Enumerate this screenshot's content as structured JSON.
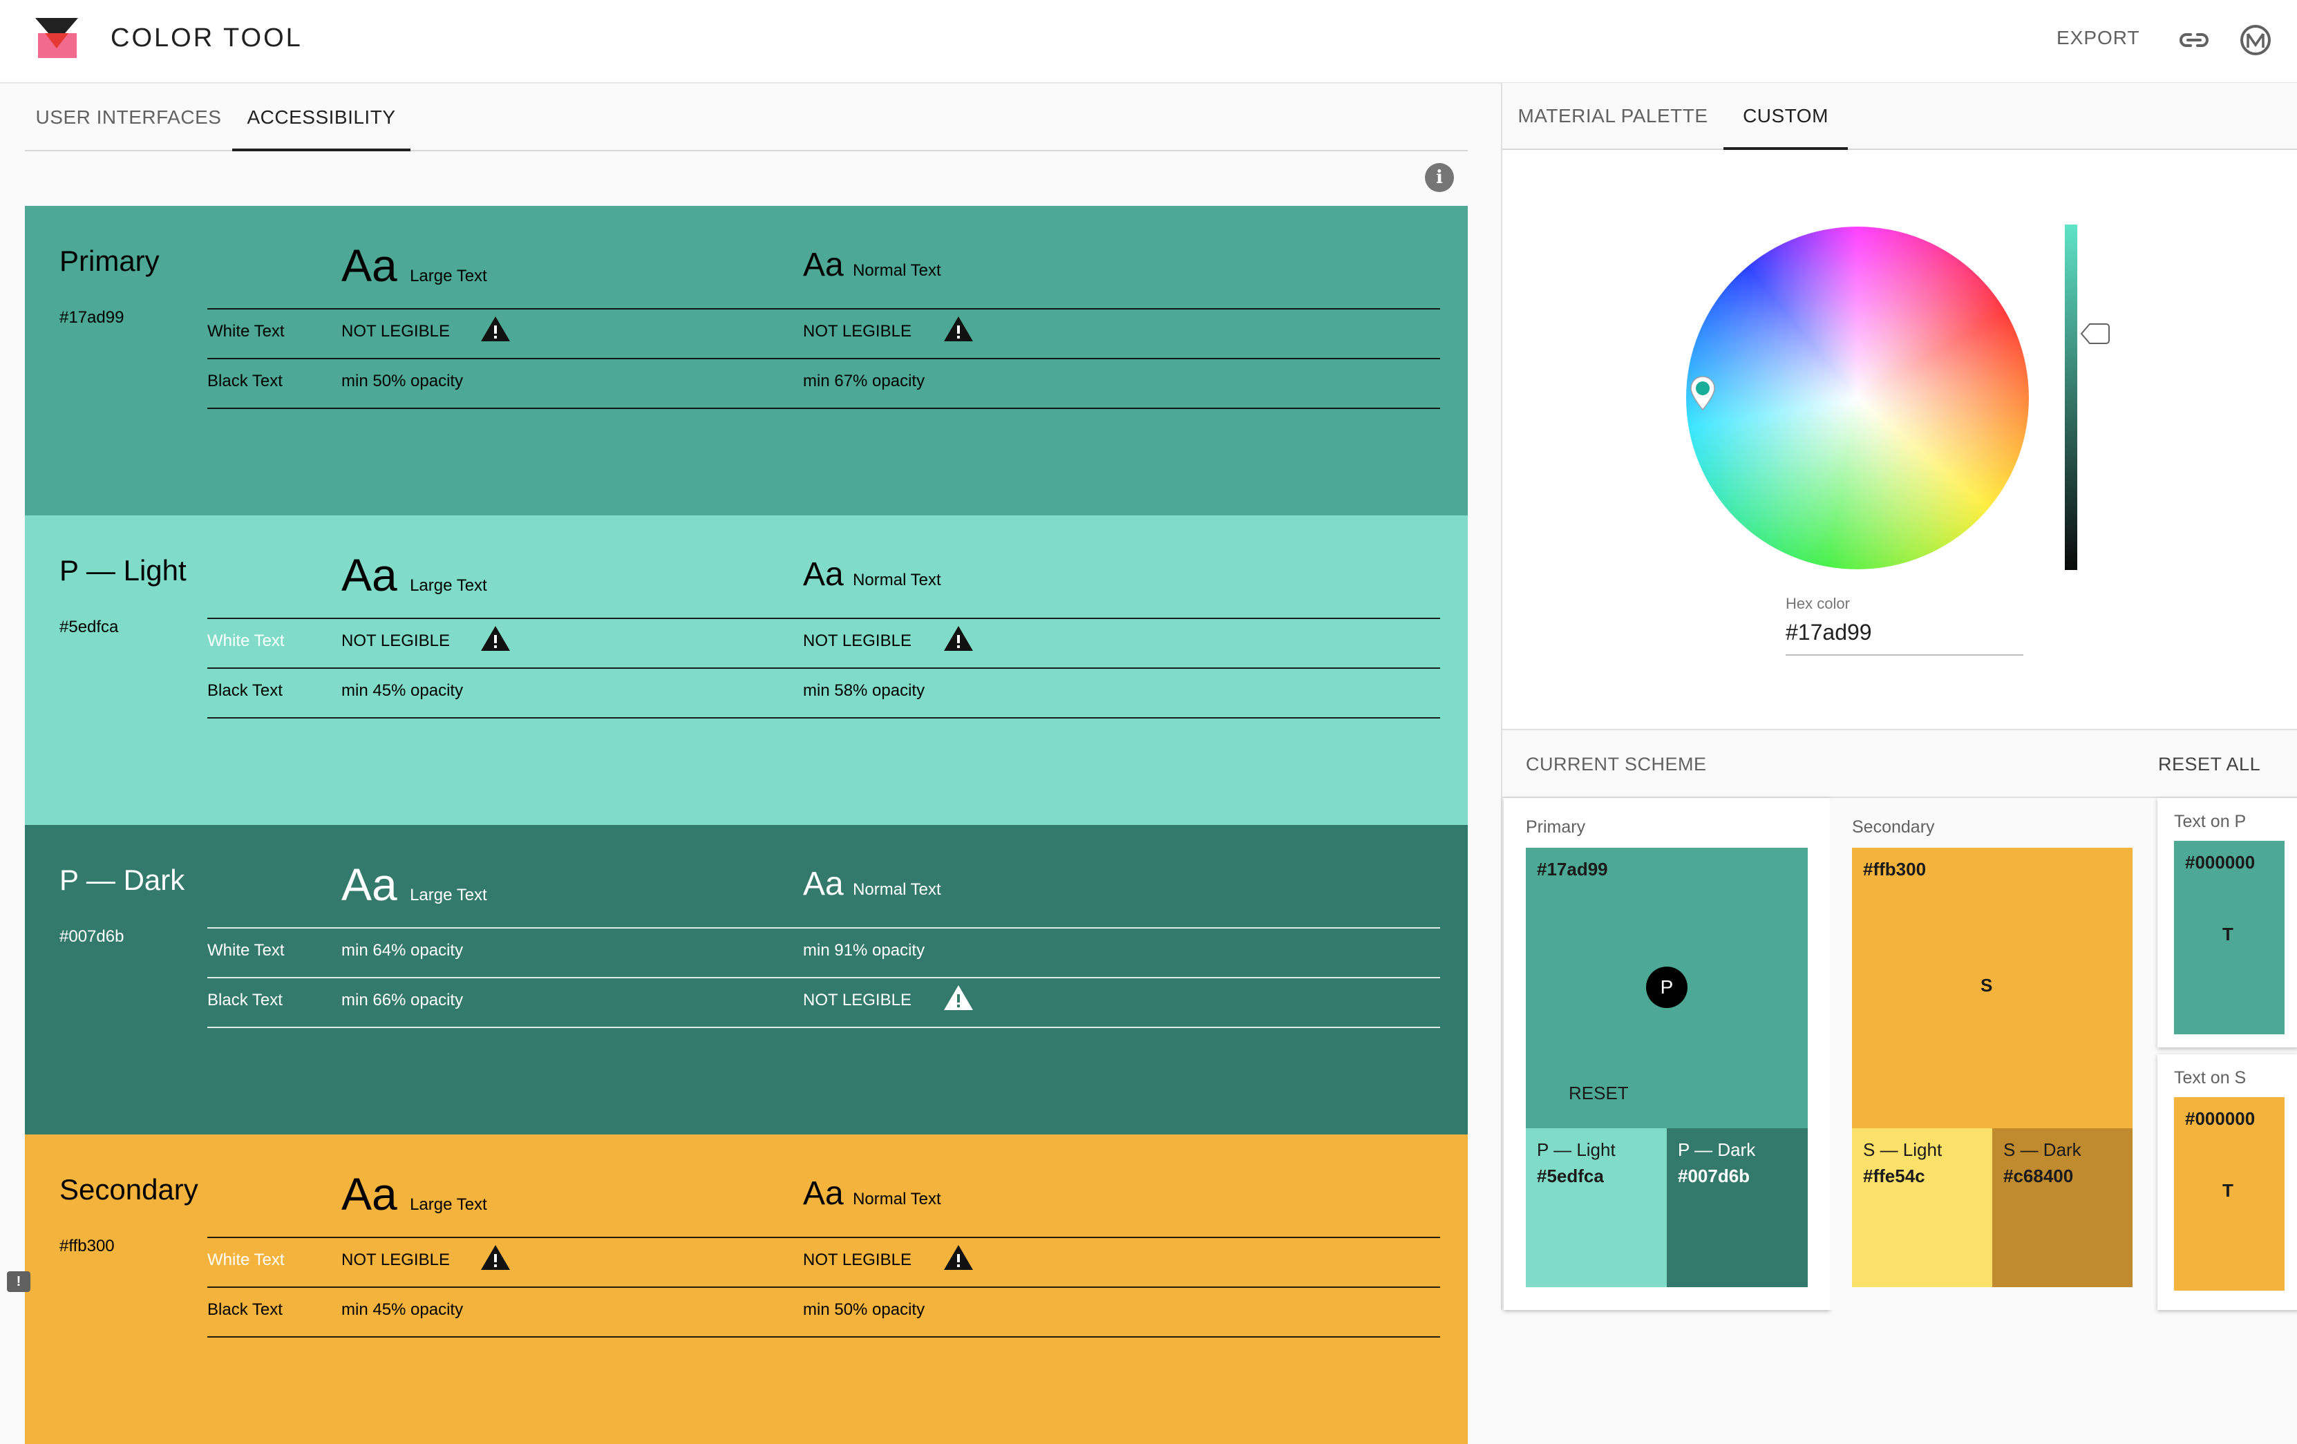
{
  "app": {
    "title": "COLOR  TOOL",
    "export_label": "EXPORT"
  },
  "left_tabs": [
    {
      "label": "USER INTERFACES",
      "active": false
    },
    {
      "label": "ACCESSIBILITY",
      "active": true
    }
  ],
  "right_tabs": [
    {
      "label": "MATERIAL PALETTE",
      "active": false
    },
    {
      "label": "CUSTOM",
      "active": true
    }
  ],
  "accessibility": {
    "large_text": "Large Text",
    "normal_text": "Normal Text",
    "aa": "Aa",
    "sections": [
      {
        "name": "Primary",
        "hex": "#17ad99",
        "bg": "#4ea896",
        "text_color": "#000000",
        "rows": [
          {
            "label": "White Text",
            "large": "NOT LEGIBLE",
            "large_warn": true,
            "normal": "NOT LEGIBLE",
            "normal_warn": true
          },
          {
            "label": "Black Text",
            "large": "min 50% opacity",
            "large_warn": false,
            "normal": "min 67% opacity",
            "normal_warn": false
          }
        ]
      },
      {
        "name": "P — Light",
        "hex": "#5edfca",
        "bg": "#80dcc8",
        "text_color": "#000000",
        "rows": [
          {
            "label": "White Text",
            "large": "NOT LEGIBLE",
            "large_warn": true,
            "normal": "NOT LEGIBLE",
            "normal_warn": true,
            "label_white": true
          },
          {
            "label": "Black Text",
            "large": "min 45% opacity",
            "large_warn": false,
            "normal": "min 58% opacity",
            "normal_warn": false
          }
        ]
      },
      {
        "name": "P — Dark",
        "hex": "#007d6b",
        "bg": "#347a6c",
        "text_color": "#ffffff",
        "rows": [
          {
            "label": "White Text",
            "large": "min 64% opacity",
            "large_warn": false,
            "normal": "min 91% opacity",
            "normal_warn": false
          },
          {
            "label": "Black Text",
            "large": "min 66% opacity",
            "large_warn": false,
            "normal": "NOT LEGIBLE",
            "normal_warn": true
          }
        ]
      },
      {
        "name": "Secondary",
        "hex": "#ffb300",
        "bg": "#f3b33d",
        "text_color": "#000000",
        "rows": [
          {
            "label": "White Text",
            "large": "NOT LEGIBLE",
            "large_warn": true,
            "normal": "NOT LEGIBLE",
            "normal_warn": true,
            "label_white": true
          },
          {
            "label": "Black Text",
            "large": "min 45% opacity",
            "large_warn": false,
            "normal": "min 50% opacity",
            "normal_warn": false
          }
        ]
      }
    ]
  },
  "custom": {
    "hex_label": "Hex color",
    "hex_value": "#17ad99"
  },
  "scheme": {
    "title": "CURRENT SCHEME",
    "reset_all": "RESET ALL",
    "primary": {
      "label": "Primary",
      "hex": "#17ad99",
      "badge": "P",
      "reset": "RESET",
      "light_title": "P — Light",
      "light_hex": "#5edfca",
      "dark_title": "P — Dark",
      "dark_hex": "#007d6b"
    },
    "secondary": {
      "label": "Secondary",
      "hex": "#ffb300",
      "badge": "S",
      "light_title": "S — Light",
      "light_hex": "#ffe54c",
      "dark_title": "S — Dark",
      "dark_hex": "#c68400"
    },
    "text_on_p": {
      "label": "Text on P",
      "hex": "#000000",
      "badge": "T"
    },
    "text_on_s": {
      "label": "Text on S",
      "hex": "#000000",
      "badge": "T"
    }
  },
  "colors": {
    "primary": "#4ea896",
    "primary_light": "#80dcc8",
    "primary_dark": "#347a6c",
    "secondary": "#f3b33d",
    "secondary_light": "#fbe06a",
    "secondary_dark": "#c08a2e"
  }
}
